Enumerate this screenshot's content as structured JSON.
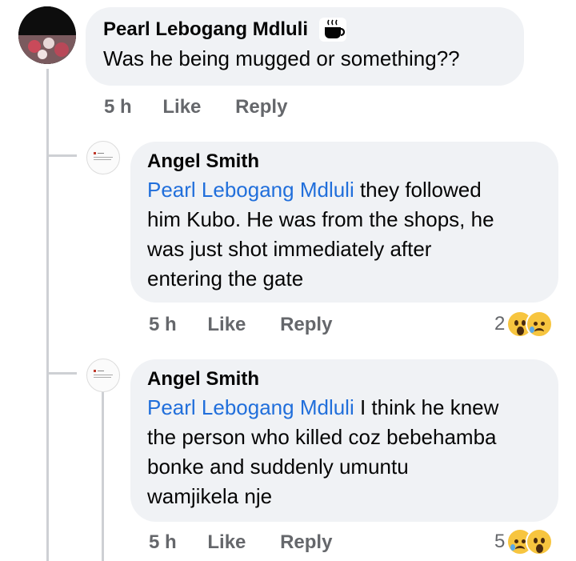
{
  "comments": [
    {
      "author": "Pearl Lebogang Mdluli",
      "badge_icon": "coffee-cup-icon",
      "text": "Was he being mugged or something??",
      "time": "5 h",
      "like": "Like",
      "reply": "Reply"
    },
    {
      "author": "Angel Smith",
      "mention": "Pearl Lebogang Mdluli",
      "lines": [
        " they followed",
        "him Kubo. He was from the shops, he",
        "was just shot immediately after",
        "entering the gate"
      ],
      "time": "5 h",
      "like": "Like",
      "reply": "Reply",
      "reaction_count": "2",
      "reactions": [
        "wow-emoji-icon",
        "sad-emoji-icon"
      ]
    },
    {
      "author": "Angel Smith",
      "mention": "Pearl Lebogang Mdluli",
      "lines": [
        " I think he knew",
        "the person who killed coz bebehamba",
        "bonke and suddenly umuntu",
        "wamjikela nje"
      ],
      "time": "5 h",
      "like": "Like",
      "reply": "Reply",
      "reaction_count": "5",
      "reactions": [
        "sad-emoji-icon",
        "wow-emoji-icon"
      ]
    }
  ],
  "colors": {
    "bubble": "#f0f2f5",
    "mention": "#216fdb",
    "meta": "#65676b"
  }
}
